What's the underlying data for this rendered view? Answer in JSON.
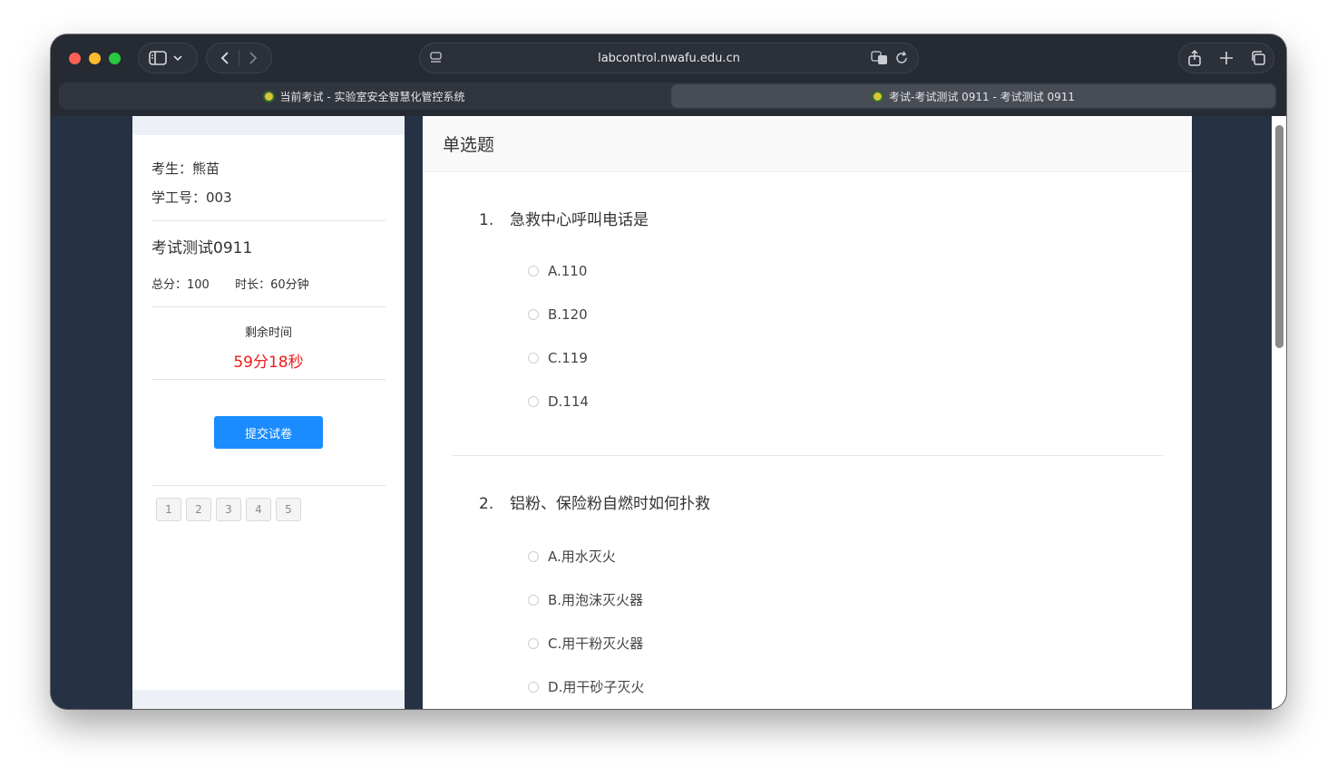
{
  "browser": {
    "url": "labcontrol.nwafu.edu.cn",
    "tabs": [
      {
        "title": "当前考试 - 实验室安全智慧化管控系统"
      },
      {
        "title": "考试-考试测试 0911 - 考试测试 0911"
      }
    ],
    "colors": {
      "chrome": "#252a33",
      "close": "#fe5f57",
      "minimize": "#febc2e",
      "zoom": "#28c840"
    }
  },
  "sidebar": {
    "student_label": "考生：熊苗",
    "id_label": "学工号：003",
    "exam_name": "考试测试0911",
    "total_score": "总分：100",
    "duration": "时长：60分钟",
    "remaining_label": "剩余时间",
    "remaining_time": "59分18秒",
    "submit_label": "提交试卷",
    "question_nav": [
      "1",
      "2",
      "3",
      "4",
      "5"
    ],
    "colors": {
      "accent": "#1a8cff",
      "timer": "#f11a1a"
    }
  },
  "main": {
    "section_title": "单选题",
    "questions": [
      {
        "number": "1.",
        "text": "急救中心呼叫电话是",
        "options": [
          "A.110",
          "B.120",
          "C.119",
          "D.114"
        ]
      },
      {
        "number": "2.",
        "text": "铝粉、保险粉自燃时如何扑救",
        "options": [
          "A.用水灭火",
          "B.用泡沫灭火器",
          "C.用干粉灭火器",
          "D.用干砂子灭火"
        ]
      }
    ]
  }
}
